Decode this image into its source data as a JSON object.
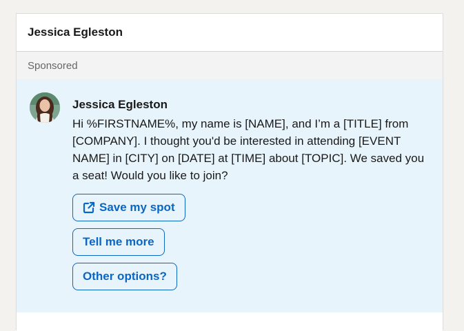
{
  "card": {
    "title": "Jessica Egleston",
    "sponsored_label": "Sponsored"
  },
  "message": {
    "sender": "Jessica Egleston",
    "avatar_icon": "person-avatar",
    "body": "Hi %FIRSTNAME%, my name is [NAME], and I’m a [TITLE] from [COMPANY]. I thought you'd be interested in attending [EVENT NAME] in [CITY] on [DATE] at [TIME] about [TOPIC]. We saved you a seat! Would you like to join?",
    "buttons": [
      {
        "label": "Save my spot",
        "icon": "external-link-icon"
      },
      {
        "label": "Tell me more"
      },
      {
        "label": "Other options?"
      }
    ]
  },
  "colors": {
    "accent": "#0a66c2",
    "message_bg": "#e8f4fc",
    "sponsored_bg": "#f3f3f3"
  }
}
